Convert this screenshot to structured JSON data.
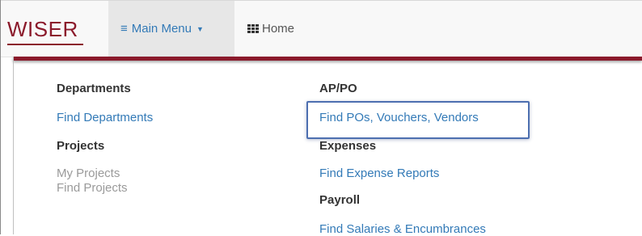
{
  "navbar": {
    "brand": "WISER",
    "main_menu_label": "Main Menu",
    "home_label": "Home"
  },
  "menu": {
    "left_column": [
      {
        "heading": "Departments",
        "items": [
          {
            "label": "Find Departments",
            "enabled": true
          }
        ]
      },
      {
        "heading": "Projects",
        "items": [
          {
            "label": "My Projects",
            "enabled": false
          },
          {
            "label": "Find Projects",
            "enabled": false
          }
        ]
      }
    ],
    "right_column": [
      {
        "heading": "AP/PO",
        "items": [
          {
            "label": "Find POs, Vouchers, Vendors",
            "enabled": true,
            "highlighted": true
          }
        ]
      },
      {
        "heading": "Expenses",
        "items": [
          {
            "label": "Find Expense Reports",
            "enabled": true
          }
        ]
      },
      {
        "heading": "Payroll",
        "items": [
          {
            "label": "Find Salaries & Encumbrances",
            "enabled": true
          }
        ]
      }
    ]
  },
  "colors": {
    "brand": "#8b1a2b",
    "link": "#337ab7",
    "heading": "#333333",
    "disabled": "#9a9a9a",
    "highlight_border": "#4d6fb0"
  },
  "icons": {
    "main_menu": "hamburger-icon",
    "main_menu_caret": "caret-down-icon",
    "home": "grid-icon"
  }
}
